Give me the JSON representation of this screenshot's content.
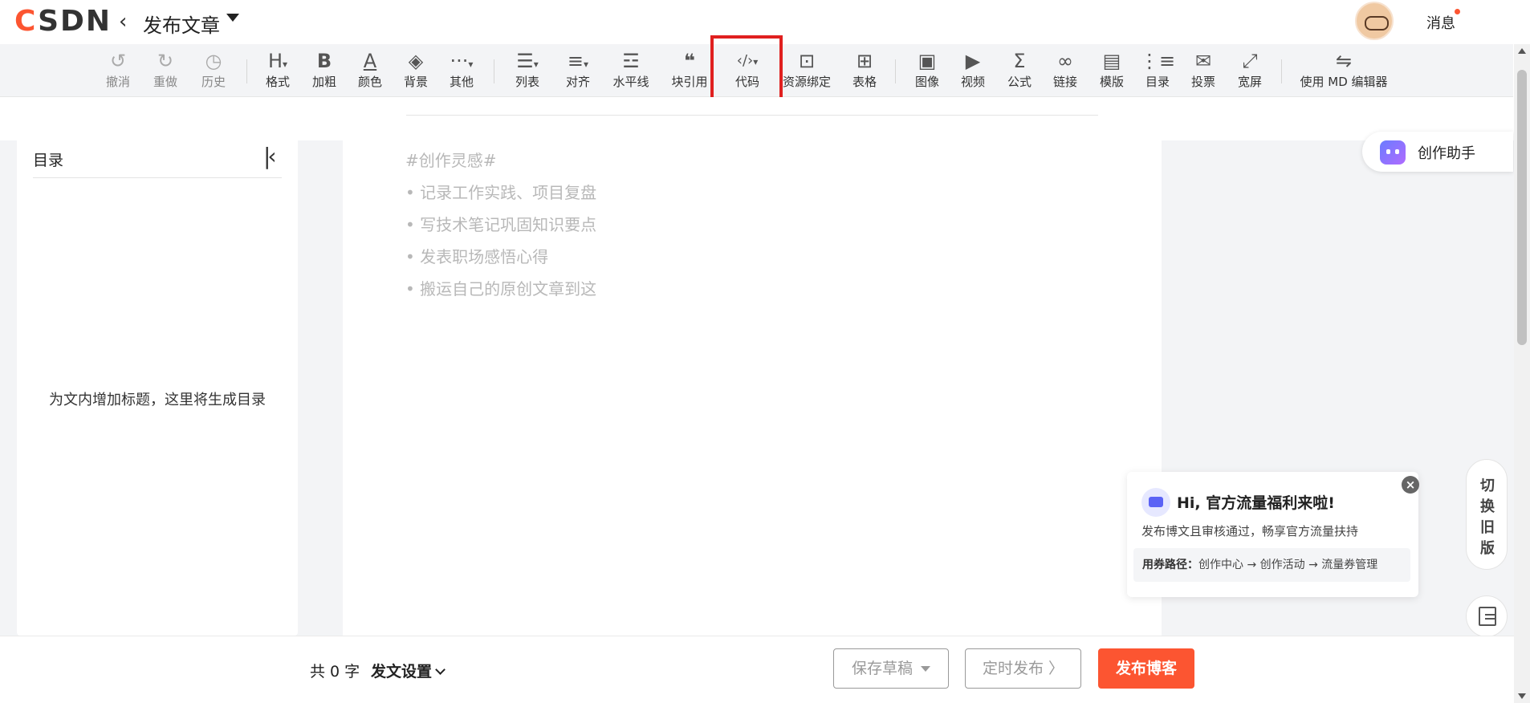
{
  "header": {
    "logo": "CSDN",
    "back_icon": "chevron-left-icon",
    "title": "发布文章",
    "messages": "消息"
  },
  "toolbar": {
    "undo": "撤消",
    "redo": "重做",
    "history": "历史",
    "format": "格式",
    "bold": "加粗",
    "color": "颜色",
    "background": "背景",
    "other": "其他",
    "list": "列表",
    "align": "对齐",
    "hr": "水平线",
    "quote": "块引用",
    "code": "代码",
    "resource": "资源绑定",
    "table": "表格",
    "image": "图像",
    "video": "视频",
    "formula": "公式",
    "link": "链接",
    "template": "模版",
    "toc": "目录",
    "vote": "投票",
    "widescreen": "宽屏",
    "md_editor": "使用 MD 编辑器"
  },
  "toc": {
    "title": "目录",
    "empty": "为文内增加标题，这里将生成目录"
  },
  "editor": {
    "inspiration_title": "#创作灵感#",
    "inspirations": [
      "• 记录工作实践、项目复盘",
      "• 写技术笔记巩固知识要点",
      "• 发表职场感悟心得",
      "• 搬运自己的原创文章到这"
    ]
  },
  "assistant": {
    "label": "创作助手"
  },
  "switch_old": {
    "chars": [
      "切",
      "换",
      "旧",
      "版"
    ]
  },
  "promo": {
    "title": "Hi, 官方流量福利来啦!",
    "subtitle": "发布博文且审核通过，畅享官方流量扶持",
    "path_label": "用券路径：",
    "path": "创作中心 → 创作活动 → 流量券管理",
    "close": "×"
  },
  "footer": {
    "word_count": "共 0 字",
    "settings": "发文设置",
    "save_draft": "保存草稿",
    "schedule": "定时发布 〉",
    "publish": "发布博客"
  },
  "colors": {
    "brand": "#fc5531",
    "highlight_box": "#e0201f"
  }
}
